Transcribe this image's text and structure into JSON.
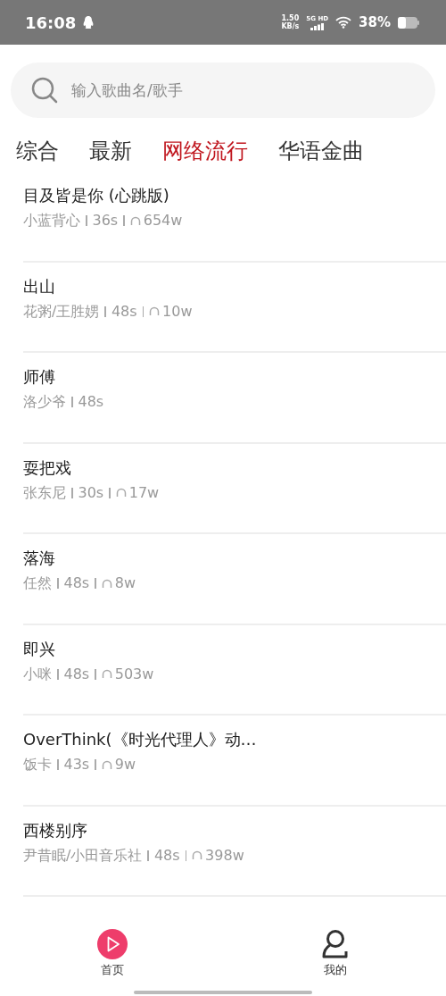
{
  "status_bar": {
    "time": "16:08",
    "speed_value": "1.50",
    "speed_unit": "KB/s",
    "network": "5G HD",
    "battery": "38%"
  },
  "search": {
    "placeholder": "输入歌曲名/歌手"
  },
  "tabs": [
    {
      "label": "综合",
      "selected": false
    },
    {
      "label": "最新",
      "selected": false
    },
    {
      "label": "网络流行",
      "selected": true
    },
    {
      "label": "华语金曲",
      "selected": false
    }
  ],
  "songs": [
    {
      "title": "目及皆是你 (心跳版)",
      "artist": "小蓝背心",
      "duration": "36s",
      "plays": "654w"
    },
    {
      "title": "出山",
      "artist": "花粥/王胜娚",
      "duration": "48s",
      "plays": "10w"
    },
    {
      "title": "师傅",
      "artist": "洛少爷",
      "duration": "48s"
    },
    {
      "title": "耍把戏",
      "artist": "张东尼",
      "duration": "30s",
      "plays": "17w"
    },
    {
      "title": "落海",
      "artist": "任然",
      "duration": "48s",
      "plays": "8w"
    },
    {
      "title": "即兴",
      "artist": "小咪",
      "duration": "48s",
      "plays": "503w"
    },
    {
      "title": "OverThink(《时光代理人》动…",
      "artist": "饭卡",
      "duration": "43s",
      "plays": "9w"
    },
    {
      "title": "西楼别序",
      "artist": "尹昔眠/小田音乐社",
      "duration": "48s",
      "plays": "398w"
    }
  ],
  "bottom_nav": [
    {
      "label": "首页",
      "kind": "play",
      "selected": true
    },
    {
      "label": "我的",
      "kind": "user",
      "selected": false
    }
  ]
}
